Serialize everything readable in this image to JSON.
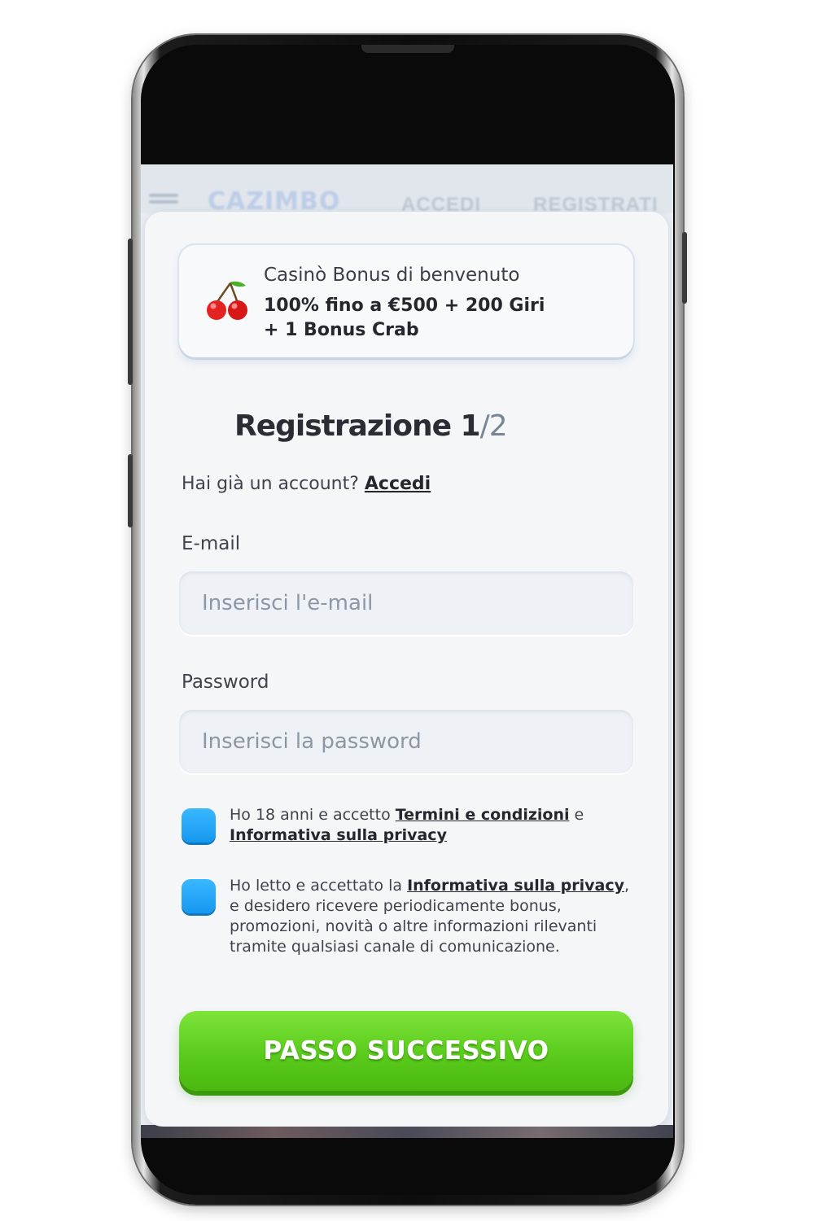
{
  "app_bar": {
    "logo_text": "CAZIMBO",
    "login_label": "ACCEDI",
    "register_label": "REGISTRATI"
  },
  "bonus": {
    "icon": "cherry-icon",
    "title": "Casinò Bonus di benvenuto",
    "line1": "100% fino a €500 + 200 Giri",
    "line2": "+ 1 Bonus Crab"
  },
  "registration": {
    "title": "Registrazione",
    "step_current": "1",
    "step_separator": "/",
    "step_total": "2"
  },
  "account": {
    "prompt": "Hai già un account?",
    "login_link": "Accedi"
  },
  "email": {
    "label": "E-mail",
    "placeholder": "Inserisci l'e-mail",
    "value": ""
  },
  "password": {
    "label": "Password",
    "placeholder": "Inserisci la password",
    "value": ""
  },
  "consent_terms": {
    "text_before": "Ho 18 anni e accetto ",
    "terms_link": "Termini e condizioni",
    "text_middle": " e ",
    "privacy_link": "Informativa sulla privacy"
  },
  "consent_marketing": {
    "text_before": "Ho letto e accettato la ",
    "privacy_link": "Informativa sulla privacy",
    "text_after": ", e desidero ricevere periodicamente bonus, promozioni, novità o altre informazioni rilevanti tramite qualsiasi canale di comunicazione."
  },
  "cta": {
    "label": "PASSO SUCCESSIVO"
  },
  "colors": {
    "checkbox": "#1fa6fa",
    "cta": "#5acb1c",
    "card_bg": "#f4f6f8"
  }
}
